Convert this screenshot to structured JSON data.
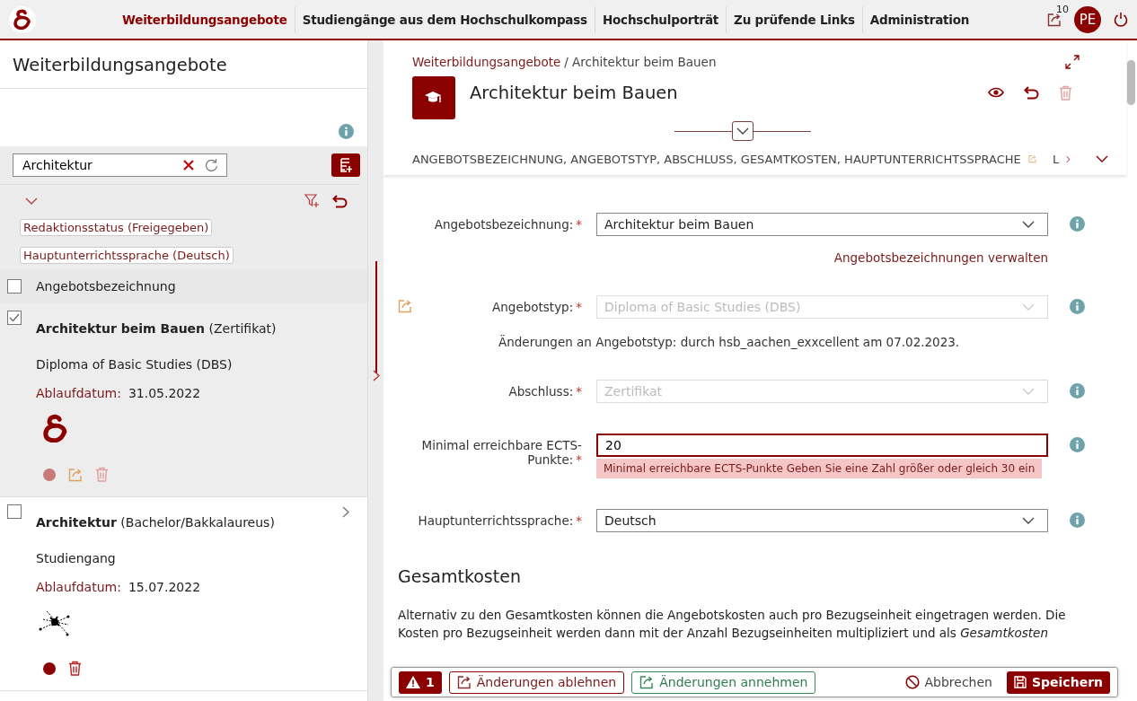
{
  "nav": {
    "items": [
      {
        "label": "Weiterbildungsangebote",
        "selected": true
      },
      {
        "label": "Studiengänge aus dem Hochschulkompass",
        "selected": false
      },
      {
        "label": "Hochschulporträt",
        "selected": false
      },
      {
        "label": "Zu prüfende Links",
        "selected": false
      },
      {
        "label": "Administration",
        "selected": false
      }
    ],
    "badge": "10",
    "avatar": "PE"
  },
  "sidebar": {
    "title": "Weiterbildungsangebote",
    "search": {
      "value": "Architektur"
    },
    "chips": [
      "Redaktionsstatus (Freigegeben)",
      "Hauptunterrichtssprache (Deutsch)"
    ],
    "header": {
      "label": "Angebotsbezeichnung",
      "checked": false
    },
    "items": [
      {
        "title": "Architektur beim Bauen",
        "type": "(Zertifikat)",
        "subtitle": "Diploma of Basic Studies (DBS)",
        "expiry_label": "Ablaufdatum:",
        "expiry": "31.05.2022",
        "kind": "with-logo",
        "checked": true,
        "selected": true,
        "expandable": false,
        "color": "#c87a7a",
        "exportable": true
      },
      {
        "title": "Architektur",
        "type": "(Bachelor/Bakkalaureus)",
        "subtitle": "Studiengang",
        "expiry_label": "Ablaufdatum:",
        "expiry": "15.07.2022",
        "kind": "with-picture",
        "checked": false,
        "selected": false,
        "expandable": true,
        "color": "#8b0000",
        "exportable": false
      }
    ]
  },
  "detail": {
    "breadcrumb": [
      {
        "label": "Weiterbildungsangebote",
        "kind": "link"
      },
      {
        "label": "/ Architektur beim Bauen",
        "kind": "current"
      }
    ],
    "title": "Architektur beim Bauen",
    "sections": "ANGEBOTSBEZEICHNUNG, ANGEBOTSTYP, ABSCHLUSS, GESAMTKOSTEN, HAUPTUNTERRICHTSSPRACHE",
    "next_section": "L",
    "fields": [
      {
        "label": "Angebotsbezeichnung:",
        "required_mark": "*",
        "kind": "select",
        "value": "Architektur beim Bauen",
        "disabled": false,
        "link": "Angebotsbezeichnungen verwalten"
      },
      {
        "label": "Angebotstyp:",
        "required_mark": "*",
        "kind": "select",
        "value": "Diploma of Basic Studies (DBS)",
        "disabled": true,
        "exportable": true,
        "note": "Änderungen an Angebotstyp: durch hsb_aachen_exxcellent am 07.02.2023."
      },
      {
        "label": "Abschluss:",
        "required_mark": "*",
        "kind": "select",
        "value": "Zertifikat",
        "disabled": true
      },
      {
        "label": "Minimal erreichbare ECTS-Punkte:",
        "required_mark": "*",
        "kind": "text",
        "value": "20",
        "disabled": false,
        "error": "Minimal erreichbare ECTS-Punkte Geben Sie eine Zahl größer oder gleich 30 ein"
      },
      {
        "label": "Hauptunterrichtssprache:",
        "required_mark": "*",
        "kind": "select",
        "value": "Deutsch",
        "disabled": false
      }
    ],
    "heading": "Gesamtkosten",
    "paragraph": "Alternativ zu den Gesamtkosten können die Angebotskosten auch pro Bezugseinheit eingetragen werden. Die Kosten pro Bezugseinheit werden dann mit der Anzahl Bezugseinheiten multipliziert und als *Gesamtkosten*"
  },
  "actions": {
    "warnings": "1",
    "reject": "Änderungen ablehnen",
    "accept": "Änderungen annehmen",
    "cancel": "Abbrechen",
    "save": "Speichern"
  }
}
